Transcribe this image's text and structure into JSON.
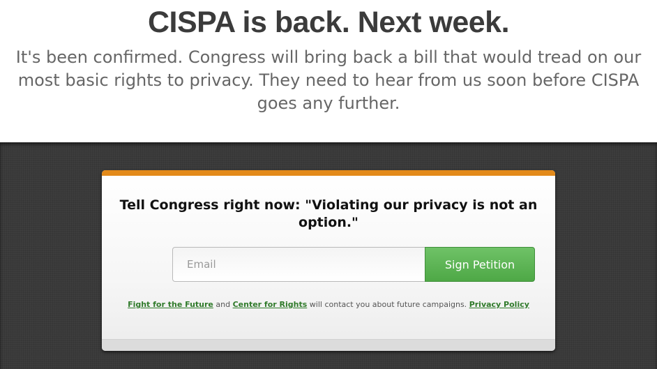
{
  "header": {
    "headline": "CISPA is back. Next week.",
    "subhead": "It's been confirmed. Congress will bring back a bill that would tread on our most basic rights to privacy. They need to hear from us soon before CISPA goes any further."
  },
  "petition": {
    "prompt": "Tell Congress right now: \"Violating our privacy is not an option.\"",
    "email_placeholder": "Email",
    "email_value": "",
    "submit_label": "Sign Petition",
    "disclaimer": {
      "link1": "Fight for the Future",
      "and": " and ",
      "link2": "Center for Rights",
      "text": " will contact you about future campaigns. ",
      "privacy_link": "Privacy Policy"
    }
  },
  "colors": {
    "accent_bar": "#e38a1a",
    "button_green": "#5cb554",
    "link_green": "#2f7a2a",
    "dark_background": "#3a3a3a"
  }
}
